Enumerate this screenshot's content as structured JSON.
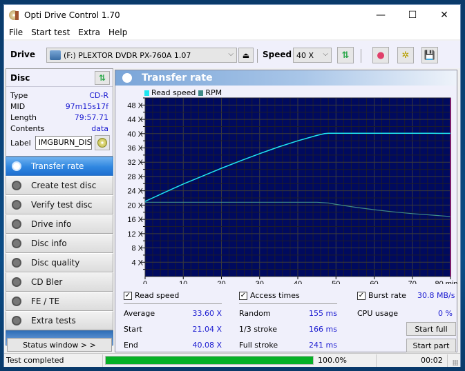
{
  "window": {
    "title": "Opti Drive Control 1.70",
    "controls": {
      "minimize": "—",
      "maximize": "☐",
      "close": "✕"
    }
  },
  "menu": [
    "File",
    "Start test",
    "Extra",
    "Help"
  ],
  "toolbar": {
    "drive_label": "Drive",
    "drive_value": "(F:)  PLEXTOR DVDR   PX-760A 1.07",
    "eject_icon": "⏏",
    "speed_label": "Speed",
    "speed_value": "40 X",
    "chevron": "⌵",
    "buttons": [
      {
        "name": "refresh-drive",
        "icon": "⇅"
      },
      {
        "name": "erase",
        "icon": "●"
      },
      {
        "name": "settings",
        "icon": "✲"
      },
      {
        "name": "save",
        "icon": "💾"
      }
    ]
  },
  "disc": {
    "header": "Disc",
    "refresh_icon": "⇅",
    "rows": [
      {
        "key": "Type",
        "value": "CD-R"
      },
      {
        "key": "MID",
        "value": "97m15s17f"
      },
      {
        "key": "Length",
        "value": "79:57.71"
      },
      {
        "key": "Contents",
        "value": "data"
      }
    ],
    "label_key": "Label",
    "label_value": "IMGBURN_DIS"
  },
  "nav": [
    {
      "label": "Transfer rate",
      "active": true
    },
    {
      "label": "Create test disc",
      "active": false
    },
    {
      "label": "Verify test disc",
      "active": false
    },
    {
      "label": "Drive info",
      "active": false
    },
    {
      "label": "Disc info",
      "active": false
    },
    {
      "label": "Disc quality",
      "active": false
    },
    {
      "label": "CD Bler",
      "active": false
    },
    {
      "label": "FE / TE",
      "active": false
    },
    {
      "label": "Extra tests",
      "active": false
    }
  ],
  "status_window_label": "Status window > >",
  "panel": {
    "title": "Transfer rate"
  },
  "chart_data": {
    "type": "line",
    "title": "Transfer rate",
    "xlabel": "min",
    "ylabel": "",
    "xlim": [
      0,
      80
    ],
    "ylim": [
      0,
      50
    ],
    "x_ticks": [
      0,
      10,
      20,
      30,
      40,
      50,
      60,
      70,
      80
    ],
    "x_tick_labels": [
      "0",
      "10",
      "20",
      "30",
      "40",
      "50",
      "60",
      "70",
      "80 min"
    ],
    "y_ticks": [
      4,
      8,
      12,
      16,
      20,
      24,
      28,
      32,
      36,
      40,
      44,
      48
    ],
    "y_tick_labels": [
      "4 X",
      "8 X",
      "12 X",
      "16 X",
      "20 X",
      "24 X",
      "28 X",
      "32 X",
      "36 X",
      "40 X",
      "44 X",
      "48 X"
    ],
    "grid": true,
    "legend": "top-left",
    "series": [
      {
        "name": "Read speed",
        "color": "#1ee6f0",
        "x": [
          0,
          2,
          5,
          10,
          15,
          20,
          25,
          30,
          35,
          40,
          45,
          47,
          48,
          50,
          55,
          60,
          65,
          70,
          75,
          80
        ],
        "y": [
          21.04,
          22.0,
          23.5,
          25.9,
          28.1,
          30.3,
          32.4,
          34.4,
          36.3,
          38.0,
          39.5,
          40.0,
          40.1,
          40.1,
          40.1,
          40.1,
          40.1,
          40.1,
          40.1,
          40.08
        ]
      },
      {
        "name": "RPM",
        "color": "#3f8a88",
        "x": [
          0,
          10,
          20,
          30,
          40,
          45,
          48,
          50,
          55,
          60,
          65,
          70,
          75,
          80
        ],
        "y": [
          20.8,
          20.8,
          20.8,
          20.8,
          20.8,
          20.8,
          20.6,
          20.2,
          19.4,
          18.7,
          18.1,
          17.6,
          17.2,
          16.8
        ]
      }
    ]
  },
  "stats": {
    "read_speed": {
      "label": "Read speed",
      "checked": true,
      "rows": [
        {
          "key": "Average",
          "value": "33.60 X"
        },
        {
          "key": "Start",
          "value": "21.04 X"
        },
        {
          "key": "End",
          "value": "40.08 X"
        }
      ]
    },
    "access_times": {
      "label": "Access times",
      "checked": true,
      "rows": [
        {
          "key": "Random",
          "value": "155 ms"
        },
        {
          "key": "1/3 stroke",
          "value": "166 ms"
        },
        {
          "key": "Full stroke",
          "value": "241 ms"
        }
      ]
    },
    "burst_rate": {
      "label": "Burst rate",
      "checked": true,
      "value": "30.8 MB/s"
    },
    "cpu_usage": {
      "label": "CPU usage",
      "value": "0 %"
    },
    "start_full": "Start full",
    "start_part": "Start part",
    "check_mark": "✓"
  },
  "statusbar": {
    "text": "Test completed",
    "progress": 100.0,
    "progress_text": "100.0%",
    "elapsed": "00:02"
  }
}
